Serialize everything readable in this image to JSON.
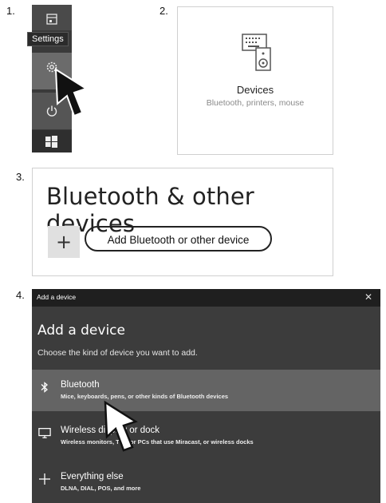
{
  "steps": {
    "s1": "1.",
    "s2": "2.",
    "s3": "3.",
    "s4": "4."
  },
  "start_menu": {
    "tooltip": "Settings",
    "icons": [
      "document-icon",
      "gear-icon",
      "power-icon",
      "windows-logo-icon"
    ]
  },
  "devices_tile": {
    "title": "Devices",
    "subtitle": "Bluetooth, printers, mouse"
  },
  "bluetooth_page": {
    "title": "Bluetooth & other devices",
    "add_button_label": "Add Bluetooth or other device",
    "plus_glyph": "+"
  },
  "add_device_dialog": {
    "titlebar": "Add a device",
    "close_glyph": "✕",
    "heading": "Add a device",
    "prompt": "Choose the kind of device you want to add.",
    "options": [
      {
        "title": "Bluetooth",
        "description": "Mice, keyboards, pens, or other kinds of Bluetooth devices",
        "icon": "bluetooth-icon"
      },
      {
        "title": "Wireless display or dock",
        "description": "Wireless monitors, TVs, or PCs that use Miracast, or wireless docks",
        "icon": "monitor-icon"
      },
      {
        "title": "Everything else",
        "description": "DLNA, DIAL, POS, and more",
        "icon": "plus-icon"
      }
    ]
  },
  "colors": {
    "dialog_bg": "#3c3c3c",
    "selected_option_bg": "#646464",
    "titlebar_bg": "#1f1f1f"
  }
}
